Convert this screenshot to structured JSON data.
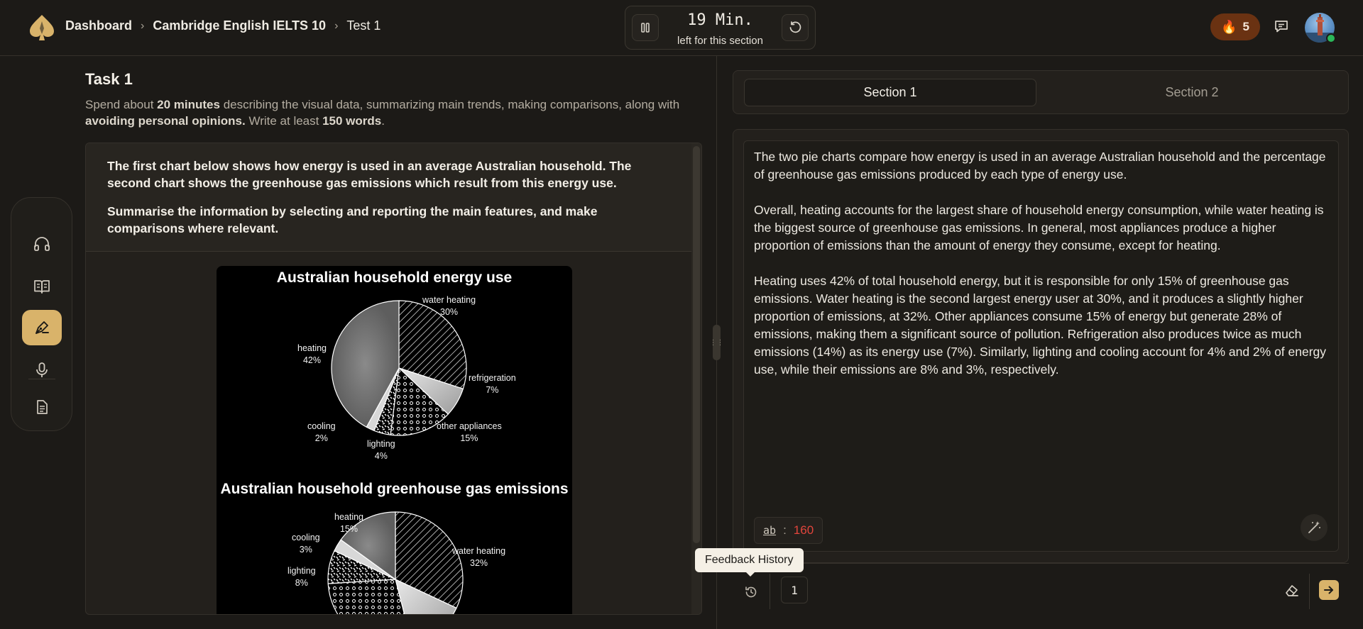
{
  "header": {
    "breadcrumbs": [
      "Dashboard",
      "Cambridge English IELTS 10",
      "Test 1"
    ],
    "timer": {
      "time": "19 Min.",
      "subtitle": "left for this section"
    },
    "streak_count": "5",
    "icons": {
      "logo": "spade-logo-icon",
      "pause": "pause-icon",
      "reset": "restart-icon",
      "streak": "flame-icon",
      "messages": "message-icon"
    },
    "colors": {
      "accent": "#d9b36a",
      "streak_bg": "#6a3212",
      "online": "#2bb85a"
    }
  },
  "sidebar": {
    "items": [
      {
        "name": "listening",
        "icon": "headphones-icon",
        "active": false
      },
      {
        "name": "reading",
        "icon": "book-icon",
        "active": false
      },
      {
        "name": "writing",
        "icon": "pen-icon",
        "active": true
      },
      {
        "name": "speaking",
        "icon": "microphone-icon",
        "active": false
      },
      {
        "name": "notes",
        "icon": "document-icon",
        "active": false
      }
    ]
  },
  "task": {
    "title": "Task 1",
    "desc_pre": "Spend about ",
    "desc_b1": "20 minutes",
    "desc_mid": " describing the visual data, summarizing main trends, making comparisons, along with ",
    "desc_b2": "avoiding personal opinions.",
    "desc_mid2": " Write at least ",
    "desc_b3": "150 words",
    "desc_end": ".",
    "prompt_1": "The first chart below shows how energy is used in an average Australian household. The second chart shows the greenhouse gas emissions which result from this energy use.",
    "prompt_2": "Summarise the information by selecting and reporting the main features, and make comparisons where relevant."
  },
  "chart_data": [
    {
      "type": "pie",
      "title": "Australian household energy use",
      "categories": [
        "water heating",
        "refrigeration",
        "other appliances",
        "lighting",
        "cooling",
        "heating"
      ],
      "values": [
        30,
        7,
        15,
        4,
        2,
        42
      ],
      "labels": [
        "30%",
        "7%",
        "15%",
        "4%",
        "2%",
        "42%"
      ]
    },
    {
      "type": "pie",
      "title": "Australian household greenhouse gas emissions",
      "categories": [
        "water heating",
        "lighting",
        "cooling",
        "heating"
      ],
      "values": [
        32,
        8,
        3,
        15
      ],
      "labels": [
        "32%",
        "8%",
        "3%",
        "15%"
      ]
    }
  ],
  "sections": {
    "tab1": "Section 1",
    "tab2": "Section 2"
  },
  "essay": {
    "p1": "The two pie charts compare how energy is used in an average Australian household and the percentage of greenhouse gas emissions produced by each type of energy use.",
    "p2": "Overall, heating accounts for the largest share of household energy consumption, while water heating is the biggest source of greenhouse gas emissions. In general, most appliances produce a higher proportion of emissions than the amount of energy they consume, except for heating.",
    "p3": "Heating uses 42% of total household energy, but it is responsible for only 15% of greenhouse gas emissions. Water heating is the second largest energy user at 30%, and it produces a slightly higher proportion of emissions, at 32%. Other appliances consume 15% of energy but generate 28% of emissions, making them a significant source of pollution. Refrigeration also produces twice as much emissions (14%) as its energy use (7%). Similarly, lighting and cooling account for 4% and 2% of energy use, while their emissions are 8% and 3%, respectively.",
    "word_count_icon": "ab",
    "word_count_sep": ":",
    "word_count": "160",
    "word_count_color": "#e2453c"
  },
  "bottom": {
    "tooltip": "Feedback History",
    "page": "1",
    "icons": {
      "history": "history-icon",
      "erase": "eraser-icon",
      "submit": "arrow-right-icon",
      "magic": "magic-wand-icon"
    }
  }
}
